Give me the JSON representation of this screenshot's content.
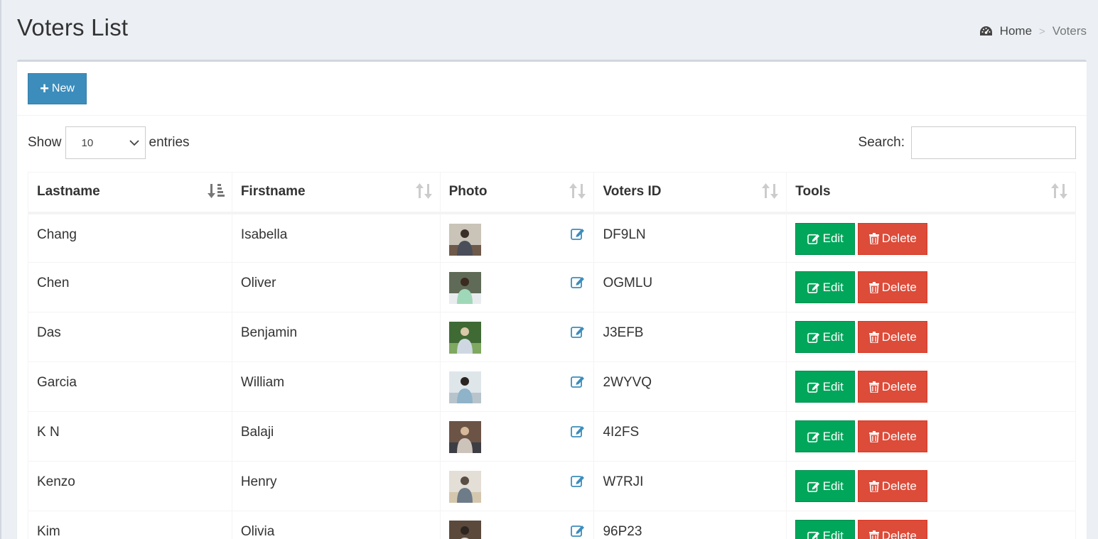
{
  "page": {
    "title": "Voters List",
    "breadcrumb": {
      "home": "Home",
      "current": "Voters",
      "separator": ">"
    }
  },
  "toolbar": {
    "new_label": "New"
  },
  "table_controls": {
    "show_label": "Show",
    "entries_label": "entries",
    "page_length": "10",
    "search_label": "Search:",
    "search_value": ""
  },
  "table": {
    "columns": [
      "Lastname",
      "Firstname",
      "Photo",
      "Voters ID",
      "Tools"
    ],
    "rows": [
      {
        "lastname": "Chang",
        "firstname": "Isabella",
        "voters_id": "DF9LN"
      },
      {
        "lastname": "Chen",
        "firstname": "Oliver",
        "voters_id": "OGMLU"
      },
      {
        "lastname": "Das",
        "firstname": "Benjamin",
        "voters_id": "J3EFB"
      },
      {
        "lastname": "Garcia",
        "firstname": "William",
        "voters_id": "2WYVQ"
      },
      {
        "lastname": "K N",
        "firstname": "Balaji",
        "voters_id": "4I2FS"
      },
      {
        "lastname": "Kenzo",
        "firstname": "Henry",
        "voters_id": "W7RJI"
      },
      {
        "lastname": "Kim",
        "firstname": "Olivia",
        "voters_id": "96P23"
      }
    ],
    "edit_label": "Edit",
    "delete_label": "Delete"
  },
  "colors": {
    "primary": "#3c8dbc",
    "success": "#00a65a",
    "danger": "#dd4b39",
    "background": "#ecf0f5"
  },
  "icons": {
    "breadcrumb": "dashboard-icon",
    "new_button": "plus-icon",
    "sort_active": "sort-alpha-asc-icon",
    "sort": "sort-icon",
    "photo_edit": "edit-icon",
    "edit": "edit-icon",
    "delete": "trash-icon"
  }
}
